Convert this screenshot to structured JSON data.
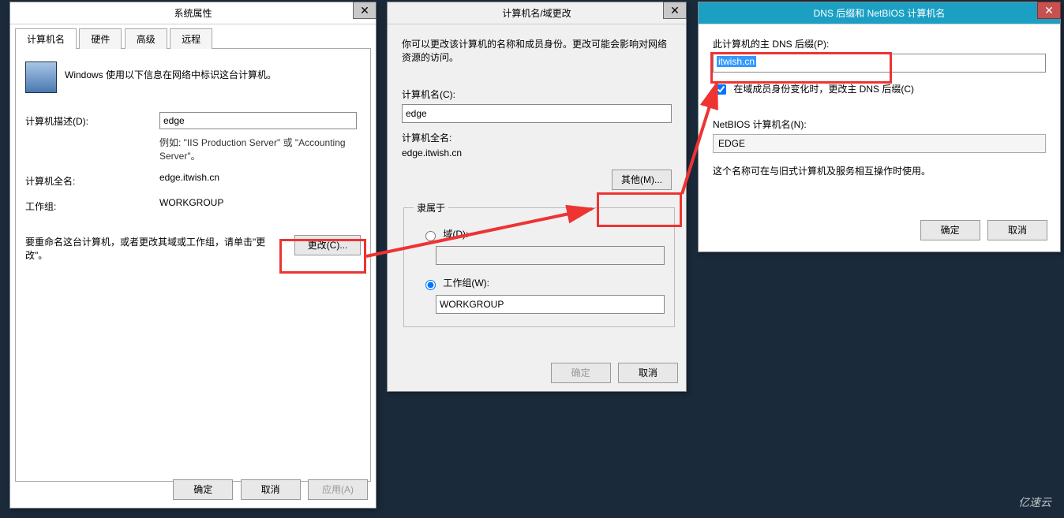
{
  "dlg1": {
    "title": "系统属性",
    "close": "✕",
    "tabs": [
      "计算机名",
      "硬件",
      "高级",
      "远程"
    ],
    "intro": "Windows 使用以下信息在网络中标识这台计算机。",
    "desc_label": "计算机描述(D):",
    "desc_value": "edge",
    "desc_hint": "例如: \"IIS Production Server\" 或 \"Accounting Server\"。",
    "fullname_label": "计算机全名:",
    "fullname_value": "edge.itwish.cn",
    "workgroup_label": "工作组:",
    "workgroup_value": "WORKGROUP",
    "rename_text": "要重命名这台计算机，或者更改其域或工作组，请单击\"更改\"。",
    "change_btn": "更改(C)...",
    "ok": "确定",
    "cancel": "取消",
    "apply": "应用(A)"
  },
  "dlg2": {
    "title": "计算机名/域更改",
    "close": "✕",
    "intro": "你可以更改该计算机的名称和成员身份。更改可能会影响对网络资源的访问。",
    "name_label": "计算机名(C):",
    "name_value": "edge",
    "fullname_label": "计算机全名:",
    "fullname_value": "edge.itwish.cn",
    "more_btn": "其他(M)...",
    "fieldset": "隶属于",
    "domain_label": "域(D):",
    "domain_value": "",
    "workgroup_label": "工作组(W):",
    "workgroup_value": "WORKGROUP",
    "ok": "确定",
    "cancel": "取消"
  },
  "dlg3": {
    "title": "DNS 后缀和 NetBIOS 计算机名",
    "close": "✕",
    "suffix_label": "此计算机的主 DNS 后缀(P):",
    "suffix_value": "itwish.cn",
    "chk_label": "在域成员身份变化时，更改主 DNS 后缀(C)",
    "chk_checked": true,
    "netbios_label": "NetBIOS 计算机名(N):",
    "netbios_value": "EDGE",
    "note": "这个名称可在与旧式计算机及服务相互操作时使用。",
    "ok": "确定",
    "cancel": "取消"
  },
  "watermark": "亿速云"
}
